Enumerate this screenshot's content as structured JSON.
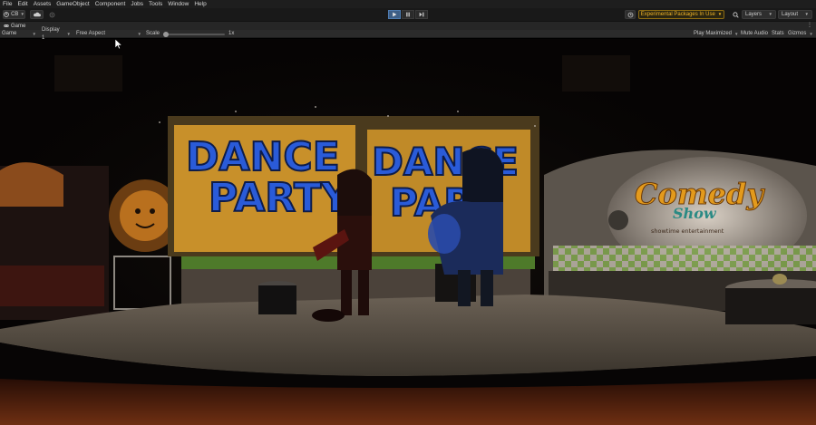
{
  "menu": [
    "File",
    "Edit",
    "Assets",
    "GameObject",
    "Component",
    "Jobs",
    "Tools",
    "Window",
    "Help"
  ],
  "toolbar": {
    "account_label": "CB",
    "experimental_label": "Experimental Packages In Use",
    "layers_label": "Layers",
    "layout_label": "Layout",
    "colors": {
      "play_active": "#3d5e86",
      "warning": "#f0b429"
    }
  },
  "tab": {
    "title": "Game"
  },
  "game_controls": {
    "view": "Game",
    "display": "Display 1",
    "aspect": "Free Aspect",
    "scale_label": "Scale",
    "scale_value": "1x",
    "scale_slider_fraction": 0,
    "play_maximized": "Play Maximized",
    "mute_audio": "Mute Audio",
    "stats": "Stats",
    "gizmos": "Gizmos"
  },
  "scene": {
    "banner_1": [
      "DANCE",
      "PARTY"
    ],
    "banner_2": [
      "DANCE",
      "PAR"
    ],
    "comedy_title": "Comedy",
    "comedy_sub": "Show",
    "comedy_tag": "showtime entertainment"
  }
}
